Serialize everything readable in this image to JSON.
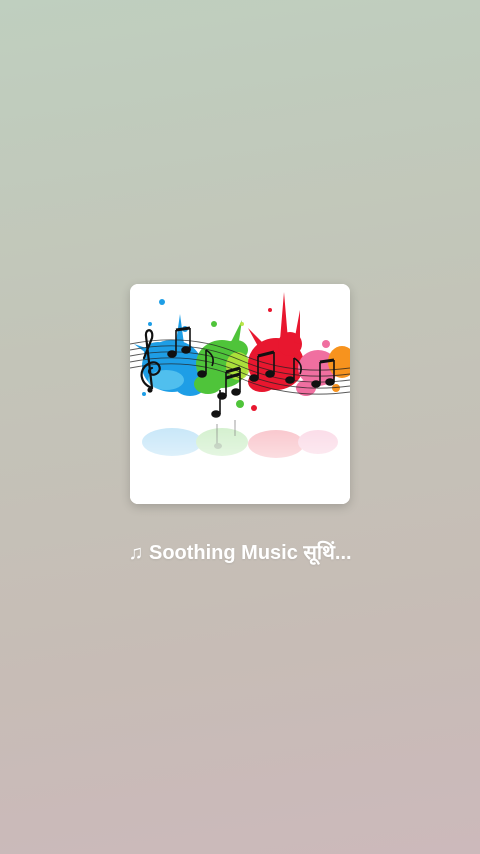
{
  "splash": {
    "app_title": "♫ Soothing Music  सूथिं...",
    "artwork_icon": "music-notes-paint-splash-icon",
    "colors": {
      "background_top": "#bfcfbf",
      "background_bottom": "#ccb9bb",
      "title_text": "#ffffff",
      "splash_blue": "#1e9ee6",
      "splash_green": "#4fc43a",
      "splash_red": "#e8172f",
      "splash_pink": "#f06fa0",
      "splash_orange": "#f7931e"
    }
  }
}
